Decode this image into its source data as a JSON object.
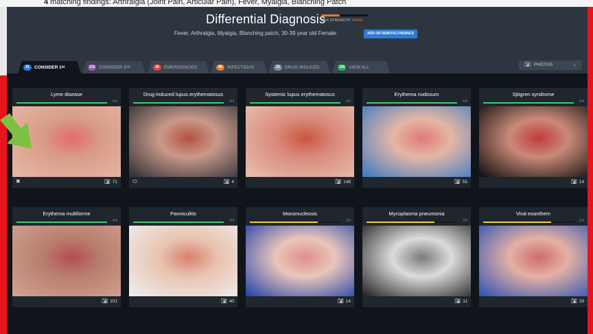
{
  "top_bar": {
    "prefix": "4",
    "text": " matching findings: Arthralgia (Joint Pain, Articular Pain), Fever, Myalgia, Blanching Patch"
  },
  "header": {
    "title": "Differential Diagnosis",
    "ddx_label": "DDX STRENGTH: ",
    "ddx_value": "WEAK",
    "ddx_strength": 0.4,
    "subtitle": "Fever, Arthralgia, Myalgia, Blanching patch, 30-39 year old Female",
    "add_button": "ADD OR REMOVE FINDINGS"
  },
  "tabs": [
    {
      "badge": "31",
      "label": "CONSIDER 1",
      "sup": "st",
      "color": "#2e7bd4",
      "active": true
    },
    {
      "badge": "119",
      "label": "CONSIDER 2",
      "sup": "nd",
      "color": "#9b59b6",
      "active": false
    },
    {
      "badge": "28",
      "label": "EMERGENCIES",
      "sup": "",
      "color": "#e0403c",
      "active": false
    },
    {
      "badge": "88",
      "label": "INFECTIOUS",
      "sup": "",
      "color": "#e8762c",
      "active": false
    },
    {
      "badge": "33",
      "label": "DRUG INDUCED",
      "sup": "",
      "color": "#7f8993",
      "active": false
    },
    {
      "badge": "150",
      "label": "VIEW ALL",
      "sup": "",
      "color": "#27ae60",
      "active": false
    }
  ],
  "photos_dropdown": {
    "label": "PHOTOS",
    "icon": "camera-icon"
  },
  "cards": [
    {
      "title": "Lyme disease",
      "ratio": "4/4",
      "match": 1.0,
      "bar_color": "#3ecf6e",
      "count": "71",
      "left_icon": "tick-icon",
      "palette": [
        "#e7b9a7",
        "#d89c88",
        "#e26b6b"
      ]
    },
    {
      "title": "Drug-induced lupus erythematosus",
      "ratio": "4/4",
      "match": 1.0,
      "bar_color": "#3ecf6e",
      "count": "4",
      "left_icon": "pill-icon",
      "palette": [
        "#2a2d33",
        "#c9998a",
        "#b5523f"
      ]
    },
    {
      "title": "Systemic lupus erythematosus",
      "ratio": "4/4",
      "match": 1.0,
      "bar_color": "#3ecf6e",
      "count": "148",
      "left_icon": "",
      "palette": [
        "#e8c2ae",
        "#d98a7c",
        "#c9553f"
      ]
    },
    {
      "title": "Erythema nodosum",
      "ratio": "4/4",
      "match": 1.0,
      "bar_color": "#3ecf6e",
      "count": "55",
      "left_icon": "",
      "palette": [
        "#3a78c2",
        "#e4b7a5",
        "#e07a78"
      ]
    },
    {
      "title": "Sjögren syndrome",
      "ratio": "4/4",
      "match": 1.0,
      "bar_color": "#3ecf6e",
      "count": "14",
      "left_icon": "",
      "palette": [
        "#0b0b0b",
        "#c98a79",
        "#c23b3b"
      ]
    },
    {
      "title": "Erythema multiforme",
      "ratio": "4/4",
      "match": 1.0,
      "bar_color": "#3ecf6e",
      "count": "101",
      "left_icon": "",
      "palette": [
        "#d1a494",
        "#b87e6d",
        "#b54c54"
      ]
    },
    {
      "title": "Panniculitis",
      "ratio": "4/4",
      "match": 1.0,
      "bar_color": "#3ecf6e",
      "count": "40",
      "left_icon": "",
      "palette": [
        "#eef0f2",
        "#e9c3b0",
        "#d8826f"
      ]
    },
    {
      "title": "Mononucleosis",
      "ratio": "3/4",
      "match": 0.75,
      "bar_color": "#f1d33b",
      "count": "14",
      "left_icon": "",
      "palette": [
        "#1f3fa8",
        "#e9c6bb",
        "#df8f88"
      ]
    },
    {
      "title": "Mycoplasma pneumonia",
      "ratio": "3/4",
      "match": 0.75,
      "bar_color": "#f1d33b",
      "count": "11",
      "left_icon": "",
      "palette": [
        "#1d1d1d",
        "#dcdcdc",
        "#7a7a7a"
      ]
    },
    {
      "title": "Viral exanthem",
      "ratio": "3/4",
      "match": 0.75,
      "bar_color": "#f1d33b",
      "count": "29",
      "left_icon": "",
      "palette": [
        "#2a4fb5",
        "#e3b1a3",
        "#cf6b70"
      ]
    }
  ]
}
